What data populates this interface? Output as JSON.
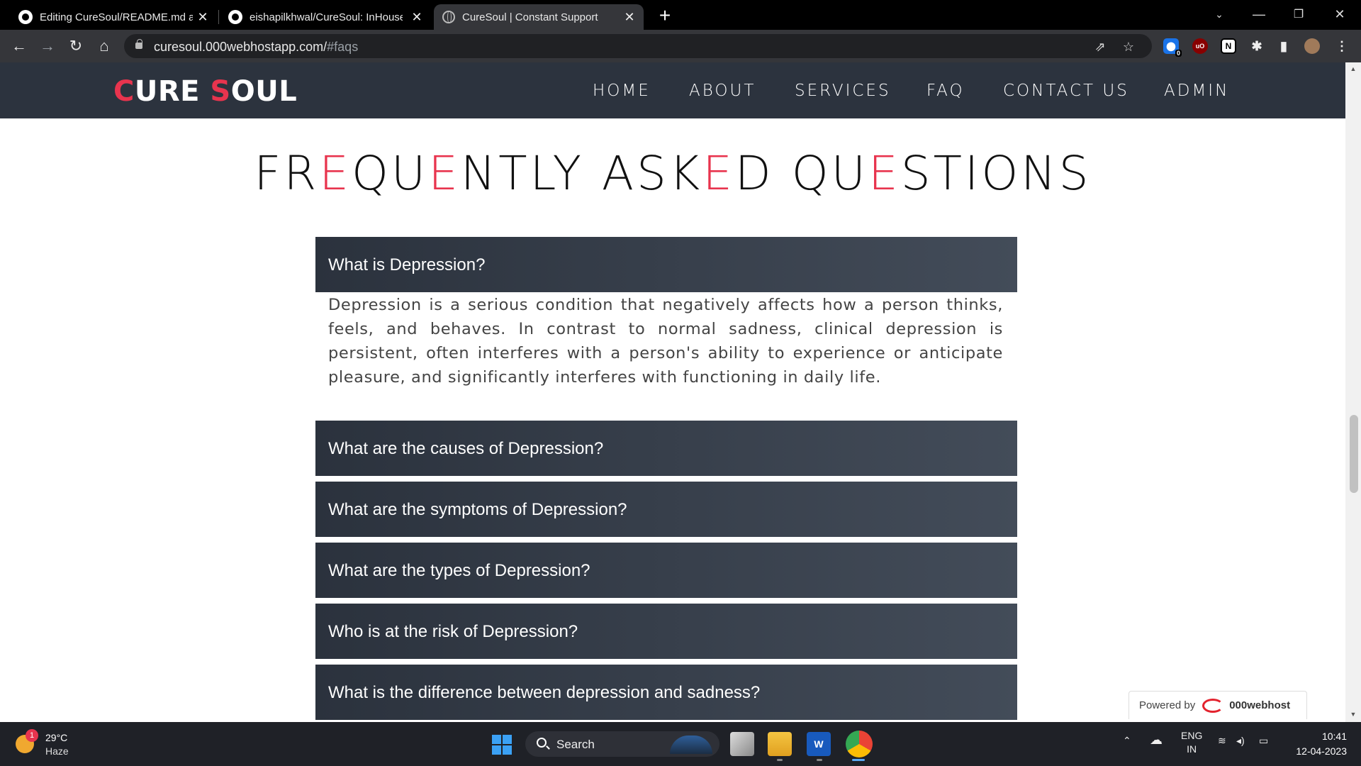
{
  "browser": {
    "tabs": [
      {
        "title": "Editing CureSoul/README.md at",
        "icon": "github-icon"
      },
      {
        "title": "eishapilkhwal/CureSoul: InHouse",
        "icon": "github-icon"
      },
      {
        "title": "CureSoul | Constant Support",
        "icon": "globe-icon"
      }
    ],
    "new_tab_label": "+",
    "url_domain": "curesoul.000webhostapp.com/",
    "url_path": "#faqs",
    "extension_badge": "0"
  },
  "site": {
    "logo_c": "C",
    "logo_ure": "URE ",
    "logo_s": "S",
    "logo_oul": "OUL",
    "nav": [
      "HOME",
      "ABOUT",
      "SERVICES",
      "FAQ",
      "CONTACT US",
      "ADMIN"
    ],
    "accent_color": "#e8344e",
    "header_color": "#2c333e"
  },
  "faq": {
    "title_parts": [
      "FR",
      "E",
      "QU",
      "E",
      "NTLY ASK",
      "E",
      "D QU",
      "E",
      "STIONS"
    ],
    "items": [
      {
        "question": "What is Depression?"
      },
      {
        "question": "What are the causes of Depression?"
      },
      {
        "question": "What are the symptoms of Depression?"
      },
      {
        "question": "What are the types of Depression?"
      },
      {
        "question": "Who is at the risk of Depression?"
      },
      {
        "question": "What is the difference between depression and sadness?"
      }
    ],
    "open_answer": "Depression is a serious condition that negatively affects how a person thinks, feels, and behaves. In contrast to normal sadness, clinical depression is persistent, often interferes with a person's ability to experience or anticipate pleasure, and significantly interferes with functioning in daily life."
  },
  "powered_by": {
    "label": "Powered by",
    "brand": "000webhost"
  },
  "taskbar": {
    "weather_temp": "29°C",
    "weather_cond": "Haze",
    "weather_badge": "1",
    "search_label": "Search",
    "lang_1": "ENG",
    "lang_2": "IN",
    "time": "10:41",
    "date": "12-04-2023"
  }
}
